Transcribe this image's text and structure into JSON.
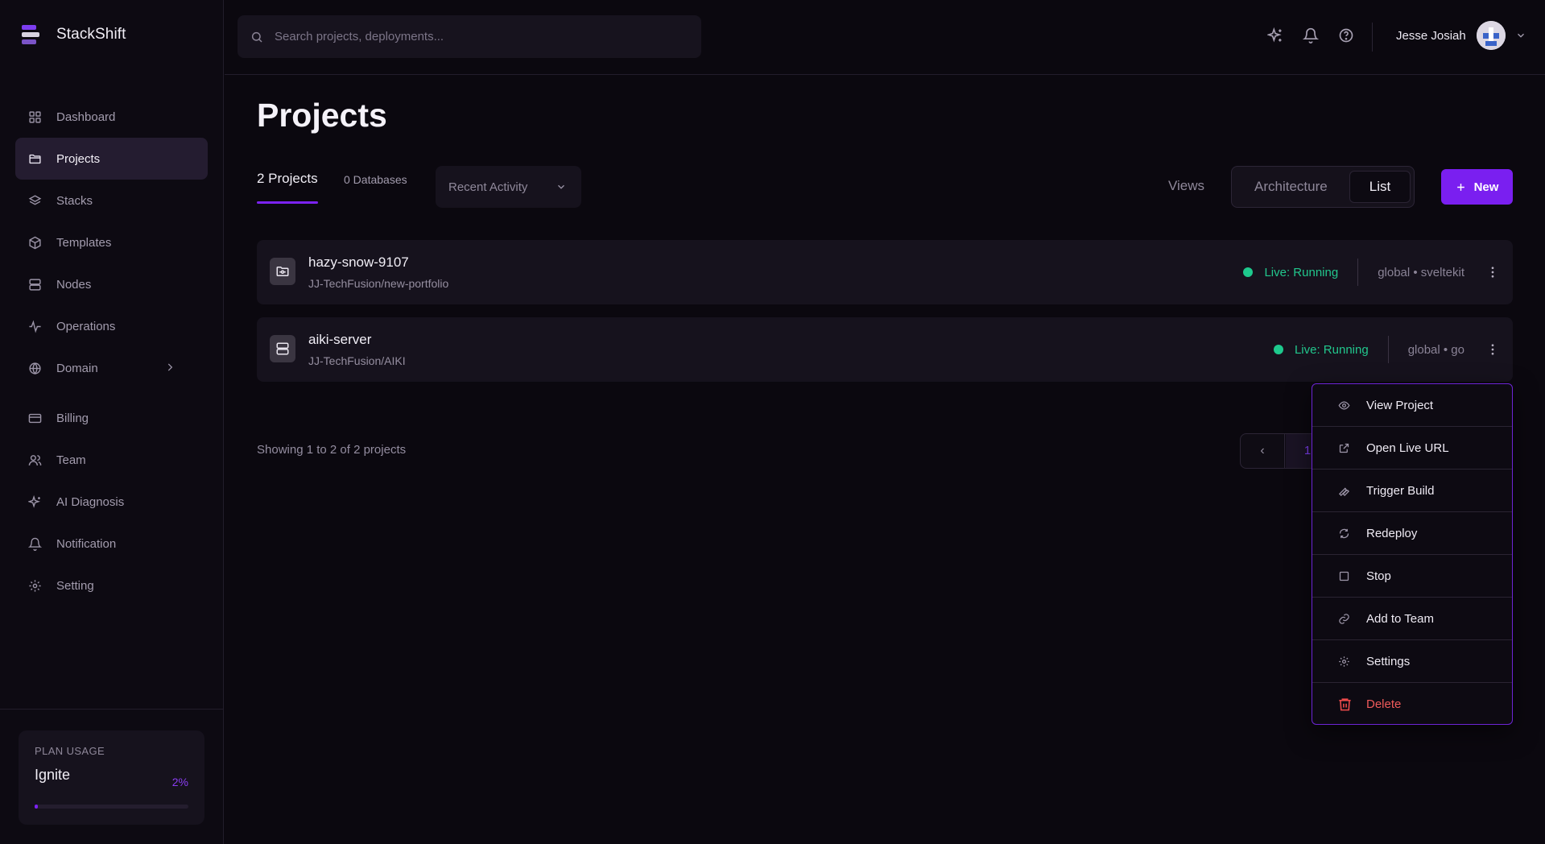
{
  "app": {
    "name": "StackShift"
  },
  "sidebar": {
    "items": [
      {
        "label": "Dashboard",
        "icon": "grid-icon"
      },
      {
        "label": "Projects",
        "icon": "folder-icon",
        "active": true
      },
      {
        "label": "Stacks",
        "icon": "layers-icon"
      },
      {
        "label": "Templates",
        "icon": "box-icon"
      },
      {
        "label": "Nodes",
        "icon": "server-icon"
      },
      {
        "label": "Operations",
        "icon": "activity-icon"
      },
      {
        "label": "Domain",
        "icon": "globe-icon",
        "has_submenu": true
      },
      {
        "label": "Billing",
        "icon": "credit-card-icon"
      },
      {
        "label": "Team",
        "icon": "users-icon"
      },
      {
        "label": "AI Diagnosis",
        "icon": "sparkles-icon"
      },
      {
        "label": "Notification",
        "icon": "bell-icon"
      },
      {
        "label": "Setting",
        "icon": "gear-icon"
      }
    ],
    "plan": {
      "label": "PLAN USAGE",
      "name": "Ignite",
      "percent_text": "2%",
      "percent": 2
    }
  },
  "topbar": {
    "search_placeholder": "Search projects, deployments...",
    "user_name": "Jesse Josiah"
  },
  "main": {
    "title": "Projects",
    "tabs": {
      "projects": "2 Projects",
      "databases": "0 Databases"
    },
    "sort": {
      "selected": "Recent Activity"
    },
    "views": {
      "label": "Views",
      "architecture": "Architecture",
      "list": "List",
      "selected": "List"
    },
    "new_button": "New",
    "projects": [
      {
        "name": "hazy-snow-9107",
        "repo": "JJ-TechFusion/new-portfolio",
        "status": "Live: Running",
        "meta": "global • sveltekit",
        "icon": "folder-git-icon"
      },
      {
        "name": "aiki-server",
        "repo": "JJ-TechFusion/AIKI",
        "status": "Live: Running",
        "meta": "global • go",
        "icon": "server-icon"
      }
    ],
    "showing": "Showing 1 to 2 of 2 projects",
    "pagination": {
      "prev": "‹",
      "current": "1"
    }
  },
  "menu": {
    "items": [
      {
        "label": "View Project",
        "icon": "eye-icon"
      },
      {
        "label": "Open Live URL",
        "icon": "external-link-icon"
      },
      {
        "label": "Trigger Build",
        "icon": "wrench-icon"
      },
      {
        "label": "Redeploy",
        "icon": "refresh-icon"
      },
      {
        "label": "Stop",
        "icon": "square-icon"
      },
      {
        "label": "Add to Team",
        "icon": "link-icon"
      },
      {
        "label": "Settings",
        "icon": "gear-icon"
      },
      {
        "label": "Delete",
        "icon": "trash-icon",
        "danger": true
      }
    ]
  },
  "colors": {
    "accent": "#7a1ff0",
    "status_live": "#22c78d",
    "danger": "#ef4b4b",
    "background": "#0b080f"
  }
}
